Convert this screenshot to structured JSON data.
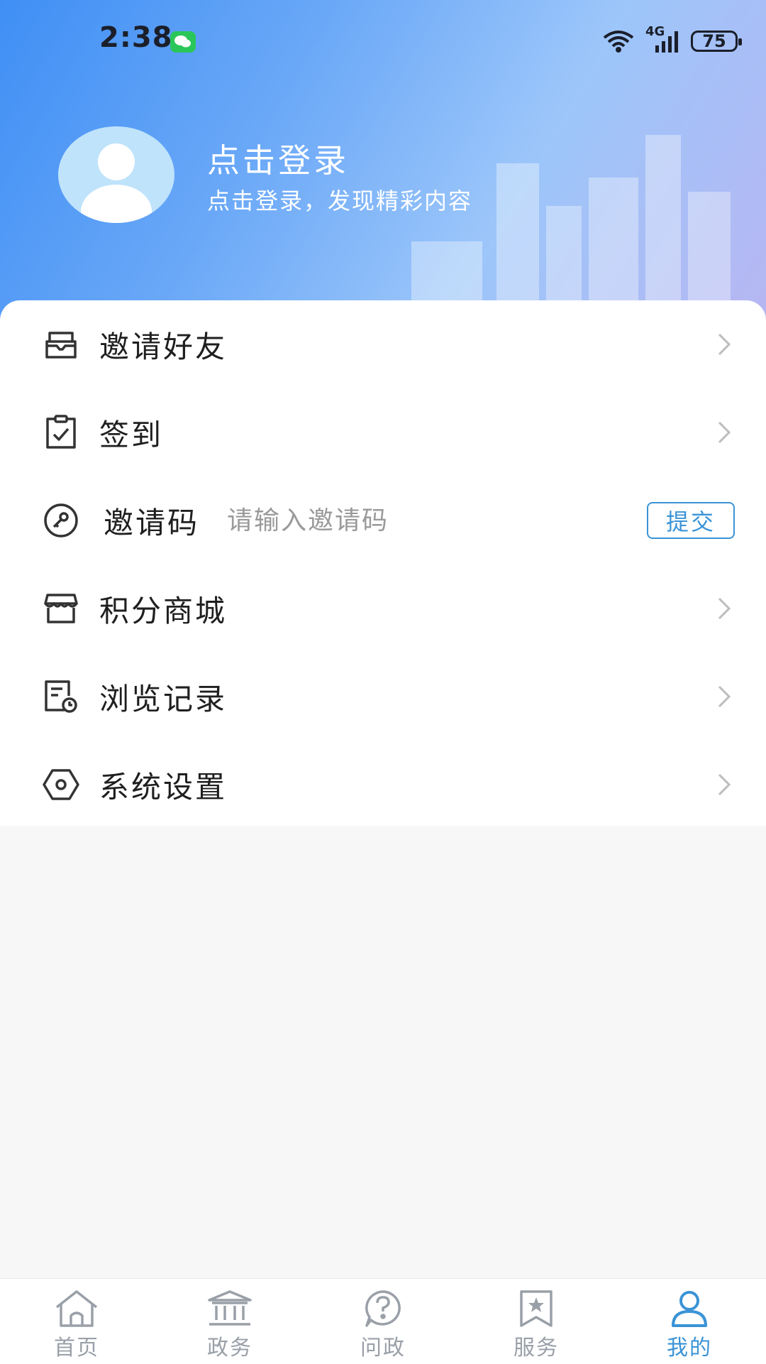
{
  "status_bar": {
    "time": "2:38",
    "network": "4G",
    "battery": "75"
  },
  "profile": {
    "title": "点击登录",
    "subtitle": "点击登录，发现精彩内容"
  },
  "menu": {
    "invite_friends": "邀请好友",
    "sign_in": "签到",
    "invite_code": {
      "label": "邀请码",
      "placeholder": "请输入邀请码",
      "submit": "提交"
    },
    "points_mall": "积分商城",
    "history": "浏览记录",
    "settings": "系统设置"
  },
  "tabbar": {
    "tabs": [
      {
        "label": "首页",
        "icon": "home-icon"
      },
      {
        "label": "政务",
        "icon": "government-icon"
      },
      {
        "label": "问政",
        "icon": "question-icon"
      },
      {
        "label": "服务",
        "icon": "service-icon"
      },
      {
        "label": "我的",
        "icon": "user-icon"
      }
    ],
    "active_index": 4
  },
  "colors": {
    "accent": "#3a93d6",
    "header_start": "#3f8ff5",
    "header_end": "#b7b6f2",
    "inactive_tab": "#9aa0a8"
  }
}
